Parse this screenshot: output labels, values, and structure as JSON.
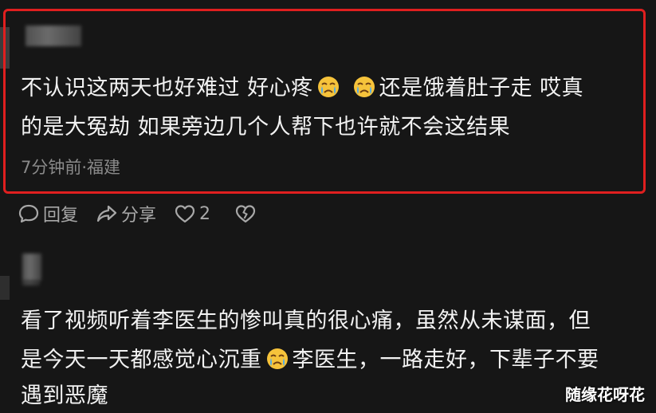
{
  "comment1": {
    "line1_before": "不认识这两天也好难过 好心疼",
    "line1_after": "还是饿着肚子走 哎真",
    "line2": "的是大冤劫 如果旁边几个人帮下也许就不会这结果",
    "meta": "7分钟前·福建",
    "emoji_name": "crying-face-icon",
    "highlight_color": "#e01f1f"
  },
  "actions": {
    "reply": "回复",
    "share": "分享",
    "like_count": "2"
  },
  "comment2": {
    "line1": "看了视频听着李医生的惨叫真的很心痛，虽然从未谋面，但",
    "line2_before": "是今天一天都感觉心沉重",
    "line2_after": "李医生，一路走好，下辈子不要",
    "line3": "遇到恶魔"
  },
  "watermark": "随缘花呀花"
}
